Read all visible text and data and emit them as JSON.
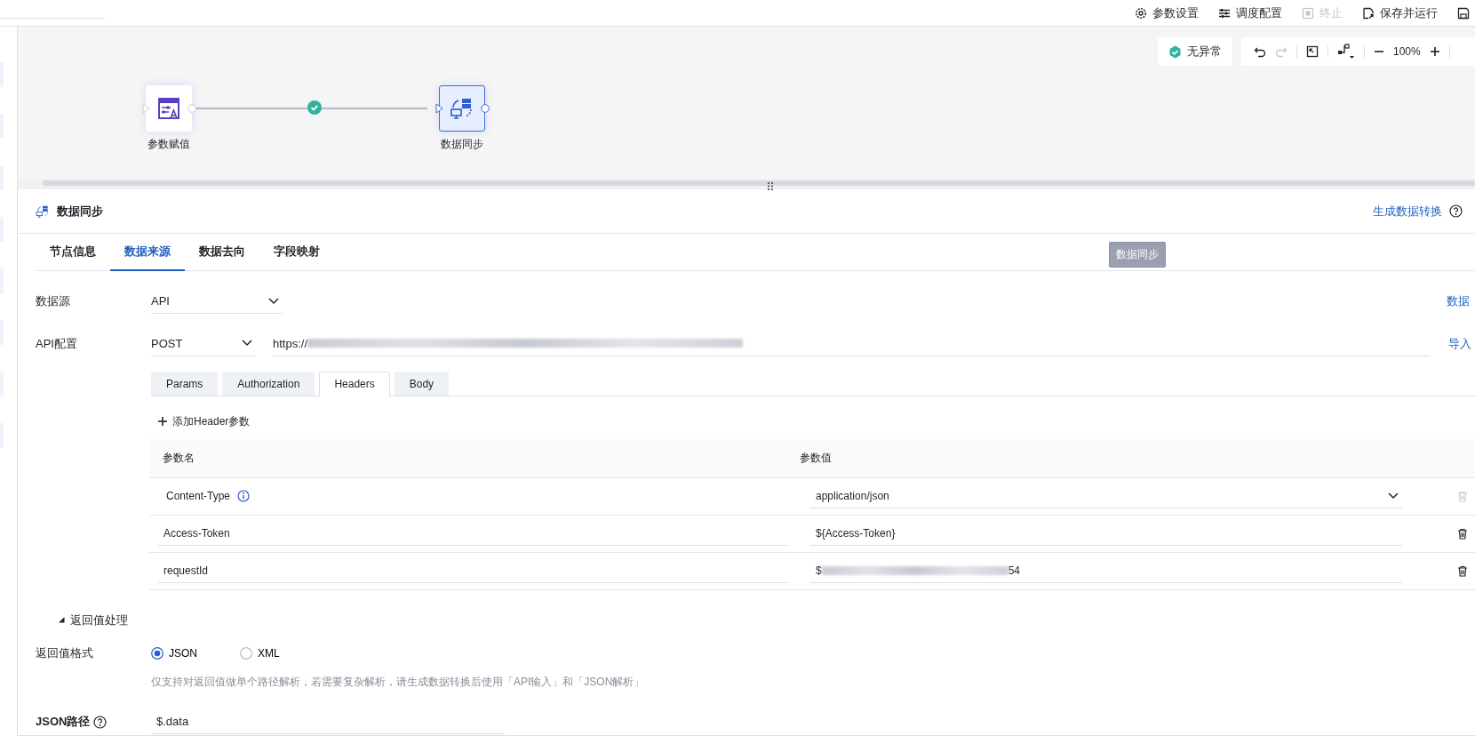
{
  "toolbar": {
    "actions": [
      {
        "label": "参数设置",
        "kind": "gear",
        "disabled": false
      },
      {
        "label": "调度配置",
        "kind": "sliders",
        "disabled": false
      },
      {
        "label": "终止",
        "kind": "stop",
        "disabled": true
      },
      {
        "label": "保存并运行",
        "kind": "saverun",
        "disabled": false
      },
      {
        "kind": "save",
        "disabled": false
      }
    ]
  },
  "canvas": {
    "status": "无异常",
    "zoom": "100%",
    "nodes": [
      {
        "label": "参数赋值",
        "kind": "assign",
        "selected": false
      },
      {
        "label": "数据同步",
        "kind": "sync",
        "selected": true
      }
    ]
  },
  "panel": {
    "title": "数据同步",
    "link": "生成数据转换",
    "tooltip": "数据同步",
    "tabs": [
      {
        "label": "节点信息",
        "selected": false
      },
      {
        "label": "数据来源",
        "selected": true
      },
      {
        "label": "数据去向",
        "selected": false
      },
      {
        "label": "字段映射",
        "selected": false
      }
    ],
    "form": {
      "datasource": {
        "label": "数据源",
        "value": "API",
        "link": "数据"
      },
      "api": {
        "label": "API配置",
        "method": "POST",
        "url": "https://",
        "link": "导入"
      },
      "request_tabs": [
        {
          "label": "Params",
          "selected": false
        },
        {
          "label": "Authorization",
          "selected": false
        },
        {
          "label": "Headers",
          "selected": true
        },
        {
          "label": "Body",
          "selected": false
        }
      ],
      "add_button": "添加Header参数",
      "columns": [
        "参数名",
        "参数值"
      ],
      "rows": [
        {
          "kind": "fixed",
          "name": "Content-Type",
          "value": "application/json",
          "delete_disabled": true
        },
        {
          "kind": "custom",
          "name": "Access-Token",
          "value": "${Access-Token}",
          "delete_disabled": false
        },
        {
          "kind": "custom",
          "name": "requestId",
          "value": "$",
          "value_tail": "54",
          "delete_disabled": false
        }
      ]
    },
    "response": {
      "title": "返回值处理",
      "expanded": true,
      "format_label": "返回值格式",
      "formats": [
        {
          "label": "JSON",
          "selected": true
        },
        {
          "label": "XML",
          "selected": false
        }
      ],
      "hint": "仅支持对返回值做单个路径解析，若需要复杂解析，请生成数据转换后使用「API输入」和「JSON解析」",
      "path_label": "JSON路径",
      "path": "$.data"
    }
  }
}
